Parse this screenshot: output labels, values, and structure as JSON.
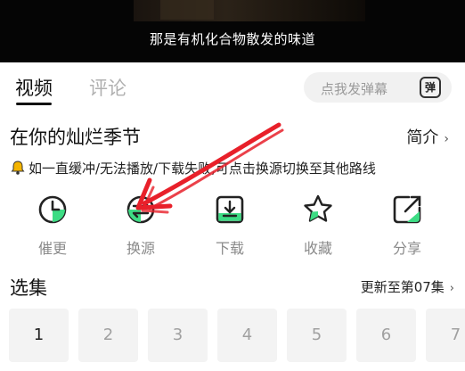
{
  "video": {
    "subtitle": "那是有机化合物散发的味道"
  },
  "tabs": {
    "video_label": "视频",
    "comments_label": "评论"
  },
  "danmu": {
    "placeholder": "点我发弹幕",
    "button_label": "弹"
  },
  "show": {
    "title": "在你的灿烂季节",
    "intro_label": "简介"
  },
  "notice": {
    "text": "如一直缓冲/无法播放/下载失败,可点击换源切换至其他路线"
  },
  "actions": [
    {
      "label": "催更",
      "icon": "clock-icon"
    },
    {
      "label": "换源",
      "icon": "switch-source-icon"
    },
    {
      "label": "下载",
      "icon": "download-icon"
    },
    {
      "label": "收藏",
      "icon": "star-icon"
    },
    {
      "label": "分享",
      "icon": "share-icon"
    }
  ],
  "episodes": {
    "header": "选集",
    "update_status": "更新至第07集",
    "items": [
      "1",
      "2",
      "3",
      "4",
      "5",
      "6",
      "7"
    ],
    "current": "1"
  },
  "colors": {
    "accent_green": "#3ddc84",
    "annotation_red": "#e8202a"
  }
}
